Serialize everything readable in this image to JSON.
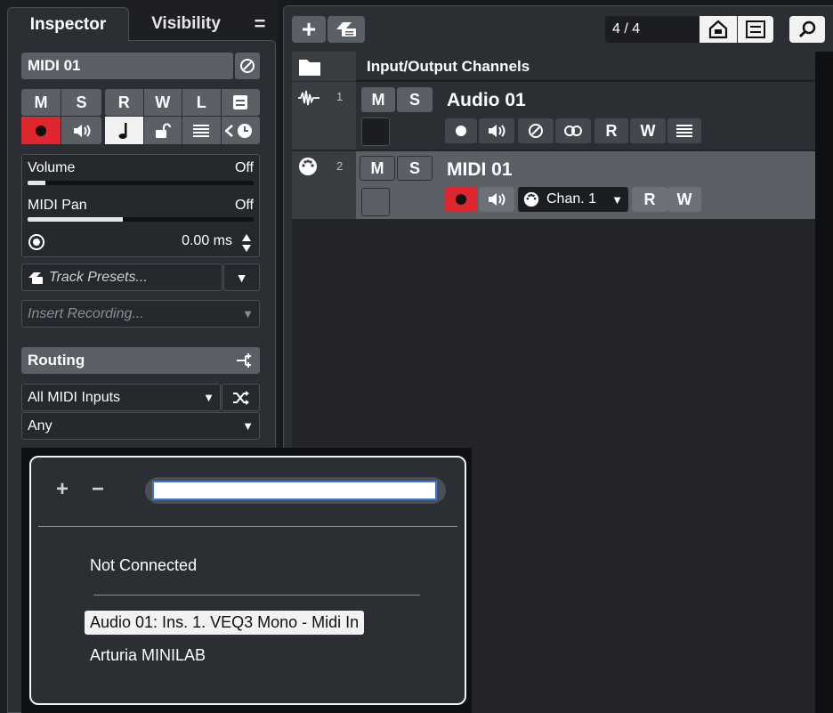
{
  "inspector": {
    "tabs": [
      "Inspector",
      "Visibility"
    ],
    "menu_glyph": "=",
    "track_name": "MIDI 01",
    "ms_labels": {
      "mute": "M",
      "solo": "S"
    },
    "rwl_labels": {
      "read": "R",
      "write": "W",
      "lock": "L"
    },
    "volume_label": "Volume",
    "volume_value": "Off",
    "pan_label": "MIDI Pan",
    "pan_value": "Off",
    "delay_value": "0.00 ms",
    "track_presets": "Track Presets...",
    "insert_recording": "Insert Recording...",
    "routing_title": "Routing",
    "midi_input": "All MIDI Inputs",
    "midi_channel": "Any",
    "dropdown_arrow": "▼"
  },
  "toolbar": {
    "add": "+",
    "counter": "4 / 4"
  },
  "tracks_header": "Input/Output Channels",
  "tracks": [
    {
      "number": "1",
      "name": "Audio 01",
      "mute": "M",
      "solo": "S",
      "read": "R",
      "write": "W"
    },
    {
      "number": "2",
      "name": "MIDI 01",
      "mute": "M",
      "solo": "S",
      "read": "R",
      "write": "W",
      "channel": "Chan. 1"
    }
  ],
  "popup": {
    "plus": "+",
    "minus": "−",
    "search_value": "",
    "items": [
      "Not Connected",
      "Audio 01: Ins. 1. VEQ3 Mono - Midi In",
      "Arturia MINILAB"
    ],
    "selected_index": 1
  },
  "colors": {
    "record_red": "#e0262e",
    "panel_bg": "#2b2e33",
    "button_gray": "#5b5f66",
    "focus_blue": "#3a78d8"
  }
}
